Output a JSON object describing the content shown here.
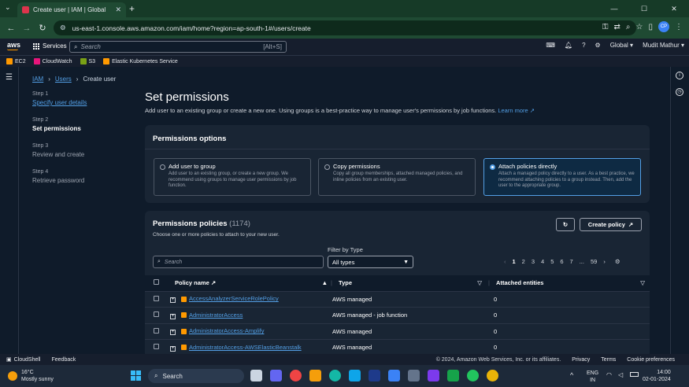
{
  "browser": {
    "tab_title": "Create user | IAM | Global",
    "url": "us-east-1.console.aws.amazon.com/iam/home?region=ap-south-1#/users/create",
    "profile_initials": "CP"
  },
  "aws_header": {
    "logo": "aws",
    "services_label": "Services",
    "search_placeholder": "Search",
    "search_hint": "[Alt+S]",
    "region": "Global",
    "user": "Mudit Mathur"
  },
  "favorites": [
    "EC2",
    "CloudWatch",
    "S3",
    "Elastic Kubernetes Service"
  ],
  "breadcrumb": {
    "iam": "IAM",
    "users": "Users",
    "current": "Create user"
  },
  "steps": [
    {
      "num": "Step 1",
      "label": "Specify user details"
    },
    {
      "num": "Step 2",
      "label": "Set permissions"
    },
    {
      "num": "Step 3",
      "label": "Review and create"
    },
    {
      "num": "Step 4",
      "label": "Retrieve password"
    }
  ],
  "page": {
    "title": "Set permissions",
    "subtitle": "Add user to an existing group or create a new one. Using groups is a best-practice way to manage user's permissions by job functions.",
    "learn_more": "Learn more"
  },
  "permissions_options": {
    "heading": "Permissions options",
    "options": [
      {
        "title": "Add user to group",
        "desc": "Add user to an existing group, or create a new group. We recommend using groups to manage user permissions by job function."
      },
      {
        "title": "Copy permissions",
        "desc": "Copy all group memberships, attached managed policies, and inline policies from an existing user."
      },
      {
        "title": "Attach policies directly",
        "desc": "Attach a managed policy directly to a user. As a best practice, we recommend attaching policies to a group instead. Then, add the user to the appropriate group."
      }
    ],
    "selected_index": 2
  },
  "policies": {
    "heading": "Permissions policies",
    "count": "(1174)",
    "description": "Choose one or more policies to attach to your new user.",
    "create_policy": "Create policy",
    "search_placeholder": "Search",
    "filter_label": "Filter by Type",
    "filter_value": "All types",
    "pages": [
      "1",
      "2",
      "3",
      "4",
      "5",
      "6",
      "7",
      "...",
      "59"
    ],
    "columns": {
      "name": "Policy name",
      "type": "Type",
      "attached": "Attached entities"
    },
    "rows": [
      {
        "name": "AccessAnalyzerServiceRolePolicy",
        "type": "AWS managed",
        "attached": "0"
      },
      {
        "name": "AdministratorAccess",
        "type": "AWS managed - job function",
        "attached": "0"
      },
      {
        "name": "AdministratorAccess-Amplify",
        "type": "AWS managed",
        "attached": "0"
      },
      {
        "name": "AdministratorAccess-AWSElasticBeanstalk",
        "type": "AWS managed",
        "attached": "0"
      }
    ]
  },
  "footer": {
    "cloudshell": "CloudShell",
    "feedback": "Feedback",
    "copyright": "© 2024, Amazon Web Services, Inc. or its affiliates.",
    "privacy": "Privacy",
    "terms": "Terms",
    "cookies": "Cookie preferences"
  },
  "taskbar": {
    "temp": "16°C",
    "weather": "Mostly sunny",
    "search": "Search",
    "lang1": "ENG",
    "lang2": "IN",
    "time": "14:00",
    "date": "02-01-2024"
  }
}
